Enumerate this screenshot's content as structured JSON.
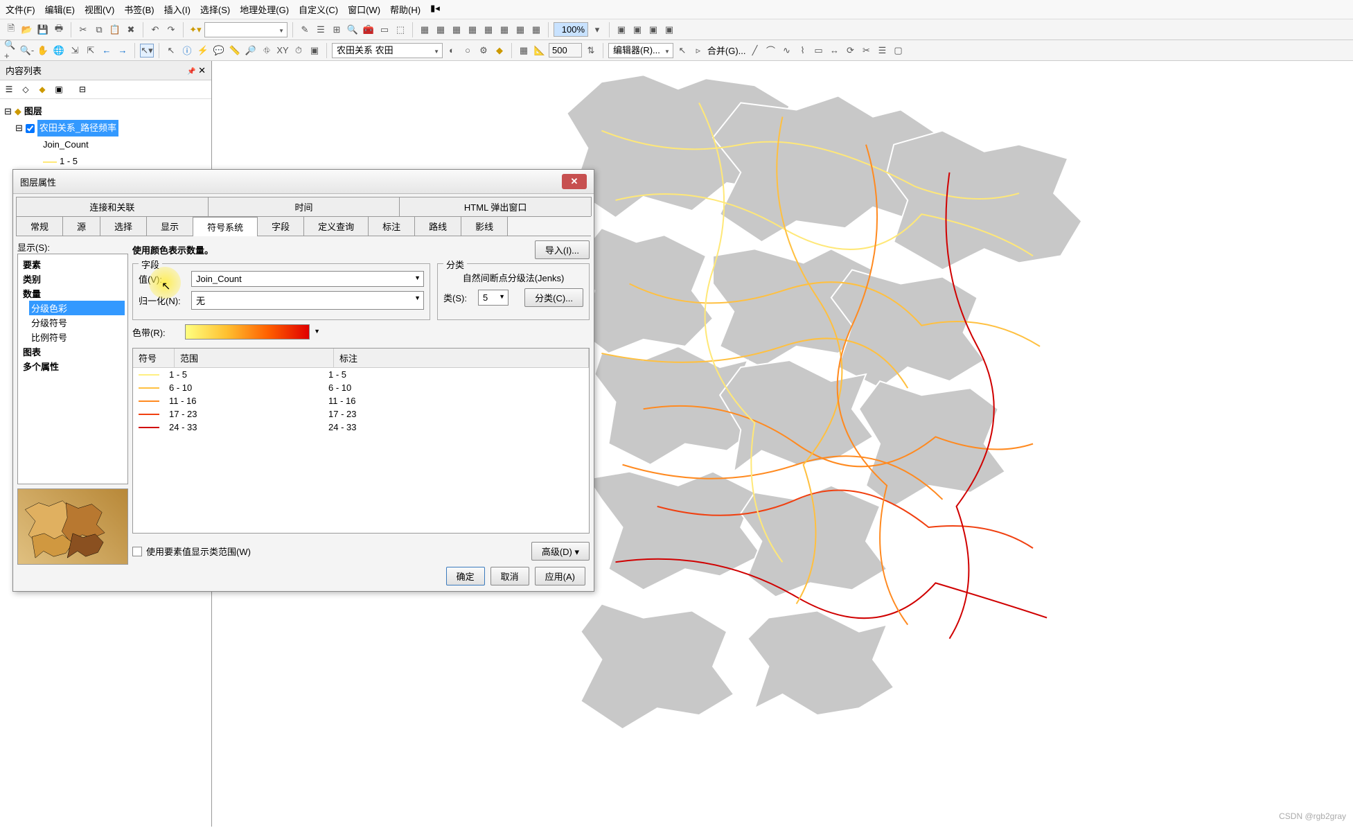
{
  "menu": {
    "file": "文件(F)",
    "edit": "编辑(E)",
    "view": "视图(V)",
    "bookmark": "书签(B)",
    "insert": "插入(I)",
    "select": "选择(S)",
    "geoprocessing": "地理处理(G)",
    "customize": "自定义(C)",
    "window": "窗口(W)",
    "help": "帮助(H)"
  },
  "toolbar": {
    "zoom_dropdown": "",
    "rel_layer": "农田关系 农田",
    "scale_percent": "100%",
    "scale_value": "500",
    "editor": "编辑器(R)...",
    "merge": "合并(G)..."
  },
  "toc": {
    "title": "内容列表",
    "root": "图层",
    "layer": "农田关系_路径频率",
    "field": "Join_Count",
    "break1": "1 - 5"
  },
  "dialog": {
    "title": "图层属性",
    "tabs_row1": [
      "连接和关联",
      "时间",
      "HTML 弹出窗口"
    ],
    "tabs_row2": [
      "常规",
      "源",
      "选择",
      "显示",
      "符号系统",
      "字段",
      "定义查询",
      "标注",
      "路线",
      "影线"
    ],
    "active_tab": "符号系统",
    "show_label": "显示(S):",
    "show_items": {
      "feature": "要素",
      "category": "类别",
      "quantity": "数量",
      "grad_color": "分级色彩",
      "grad_symbol": "分级符号",
      "prop_symbol": "比例符号",
      "chart": "图表",
      "multi": "多个属性"
    },
    "desc": "使用颜色表示数量。",
    "import_btn": "导入(I)...",
    "field_legend": "字段",
    "value_label": "值(V):",
    "value_sel": "Join_Count",
    "norm_label": "归一化(N):",
    "norm_sel": "无",
    "classify_legend": "分类",
    "classify_method": "自然间断点分级法(Jenks)",
    "classes_label": "类(S):",
    "classes_n": "5",
    "classify_btn": "分类(C)...",
    "ramp_label": "色带(R):",
    "table_hdrs": {
      "symbol": "符号",
      "range": "范围",
      "label": "标注"
    },
    "rows": [
      {
        "color": "#ffef80",
        "range": "1 - 5",
        "label": "1 - 5"
      },
      {
        "color": "#ffc040",
        "range": "6 - 10",
        "label": "6 - 10"
      },
      {
        "color": "#ff8a20",
        "range": "11 - 16",
        "label": "11 - 16"
      },
      {
        "color": "#f04010",
        "range": "17 - 23",
        "label": "17 - 23"
      },
      {
        "color": "#d00000",
        "range": "24 - 33",
        "label": "24 - 33"
      }
    ],
    "use_feature_chk": "使用要素值显示类范围(W)",
    "advanced_btn": "高级(D)",
    "ok": "确定",
    "cancel": "取消",
    "apply": "应用(A)"
  },
  "watermark": "CSDN @rgb2gray"
}
